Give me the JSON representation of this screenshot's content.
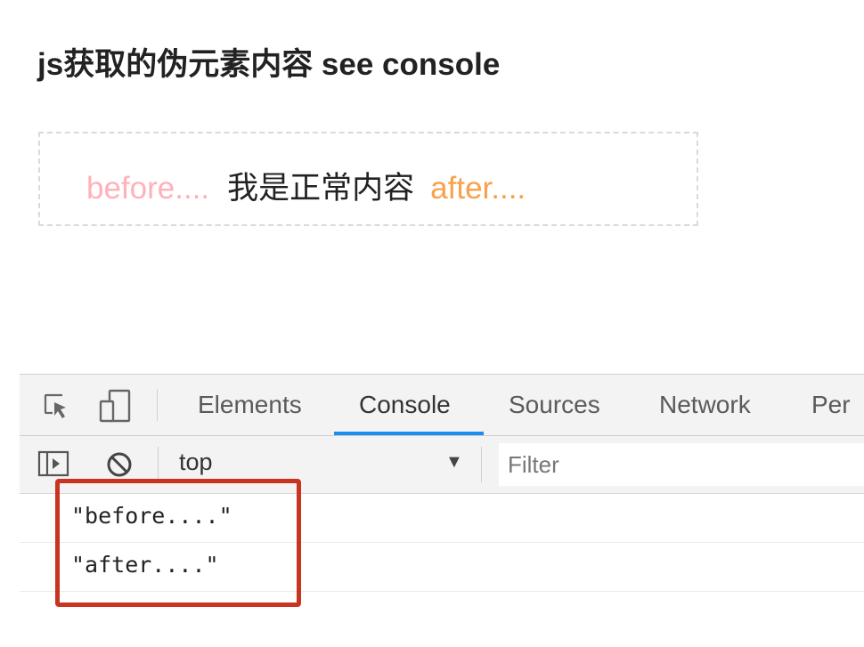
{
  "page": {
    "title": "js获取的伪元素内容 see console",
    "demo": {
      "before": "before....",
      "content": "我是正常内容",
      "after": "after...."
    }
  },
  "devtools": {
    "tabs": [
      "Elements",
      "Console",
      "Sources",
      "Network",
      "Per"
    ],
    "active_tab": "Console",
    "context": "top",
    "filter_placeholder": "Filter",
    "console_lines": [
      "\"before....\"",
      "\"after....\""
    ]
  },
  "colors": {
    "before": "#ffb1bb",
    "after": "#f7a24a",
    "tab_accent": "#1a8ef0",
    "highlight": "#c8341f"
  },
  "icons": [
    "inspect-element-icon",
    "device-toolbar-icon",
    "sidebar-toggle-icon",
    "clear-console-icon",
    "dropdown-arrow-icon"
  ]
}
